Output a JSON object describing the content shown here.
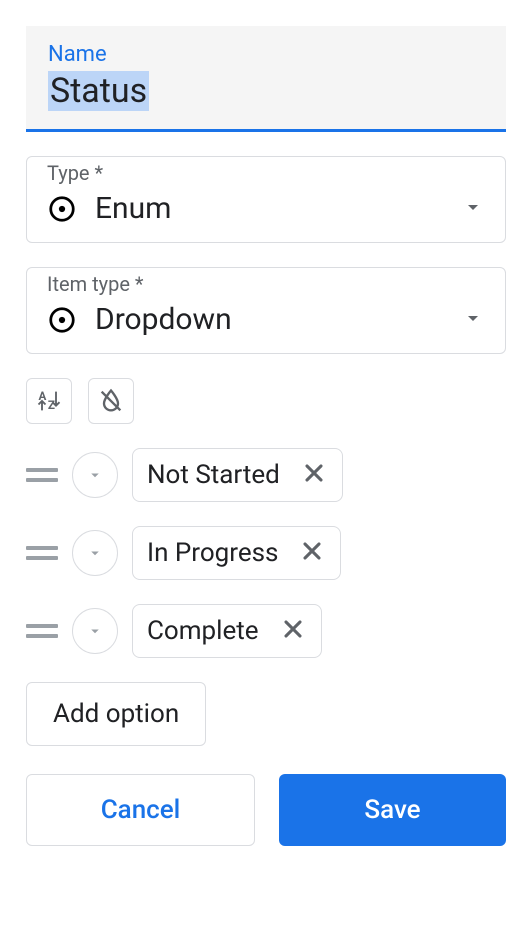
{
  "nameField": {
    "label": "Name",
    "value": "Status"
  },
  "typeField": {
    "label": "Type *",
    "value": "Enum"
  },
  "itemTypeField": {
    "label": "Item type *",
    "value": "Dropdown"
  },
  "options": [
    {
      "label": "Not Started"
    },
    {
      "label": "In Progress"
    },
    {
      "label": "Complete"
    }
  ],
  "addOptionLabel": "Add option",
  "actions": {
    "cancel": "Cancel",
    "save": "Save"
  }
}
